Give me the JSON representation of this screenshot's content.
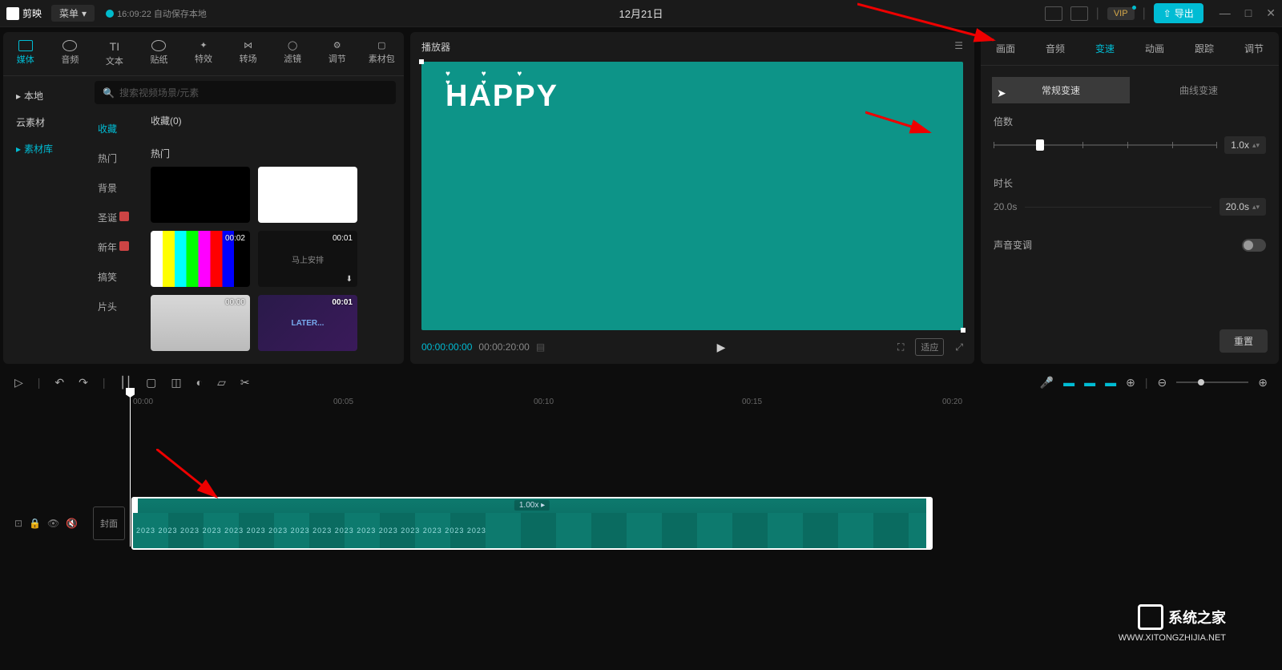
{
  "titlebar": {
    "app_name": "剪映",
    "menu_label": "菜单",
    "autosave": "16:09:22 自动保存本地",
    "project_title": "12月21日",
    "vip_label": "VIP",
    "export_label": "导出"
  },
  "media_tabs": [
    {
      "label": "媒体",
      "active": true
    },
    {
      "label": "音频",
      "active": false
    },
    {
      "label": "文本",
      "active": false
    },
    {
      "label": "贴纸",
      "active": false
    },
    {
      "label": "特效",
      "active": false
    },
    {
      "label": "转场",
      "active": false
    },
    {
      "label": "滤镜",
      "active": false
    },
    {
      "label": "调节",
      "active": false
    },
    {
      "label": "素材包",
      "active": false
    }
  ],
  "side_nav": [
    {
      "label": "本地",
      "active": false,
      "chevron": true
    },
    {
      "label": "云素材",
      "active": false
    },
    {
      "label": "素材库",
      "active": true
    }
  ],
  "search_placeholder": "搜索视频场景/元素",
  "sub_nav": [
    {
      "label": "收藏",
      "active": true
    },
    {
      "label": "热门"
    },
    {
      "label": "背景"
    },
    {
      "label": "圣诞",
      "badge": "新"
    },
    {
      "label": "新年",
      "badge": "新"
    },
    {
      "label": "搞笑"
    },
    {
      "label": "片头"
    }
  ],
  "collection_label": "收藏(0)",
  "hot_label": "热门",
  "thumbs": [
    {
      "time": "",
      "type": "black"
    },
    {
      "time": "",
      "type": "white"
    },
    {
      "time": "00:02",
      "type": "bars"
    },
    {
      "time": "00:01",
      "type": "dark",
      "text": "马上安排"
    },
    {
      "time": "00:00",
      "type": "face"
    },
    {
      "time": "00:01",
      "type": "later",
      "text": "LATER..."
    }
  ],
  "player": {
    "header": "播放器",
    "overlay_text": "HAPPY",
    "time_current": "00:00:00:00",
    "time_total": "00:00:20:00",
    "ratio_label": "适应"
  },
  "props_tabs": [
    {
      "label": "画面"
    },
    {
      "label": "音频"
    },
    {
      "label": "变速",
      "active": true
    },
    {
      "label": "动画"
    },
    {
      "label": "跟踪"
    },
    {
      "label": "调节"
    }
  ],
  "speed_modes": [
    {
      "label": "常规变速",
      "active": true
    },
    {
      "label": "曲线变速"
    }
  ],
  "speed": {
    "label": "倍数",
    "value": "1.0x"
  },
  "duration": {
    "label": "时长",
    "current": "20.0s",
    "value": "20.0s"
  },
  "pitch": {
    "label": "声音变调"
  },
  "reset_label": "重置",
  "ruler_marks": [
    "00:00",
    "00:05",
    "00:10",
    "00:15",
    "00:20"
  ],
  "clip": {
    "label": "1.00x ▸",
    "frame_text": "2023 2023 2023 2023 2023 2023 2023 2023 2023 2023 2023 2023 2023 2023 2023 2023"
  },
  "cover_label": "封面",
  "watermark": {
    "text": "系统之家",
    "url": "WWW.XITONGZHIJIA.NET"
  }
}
